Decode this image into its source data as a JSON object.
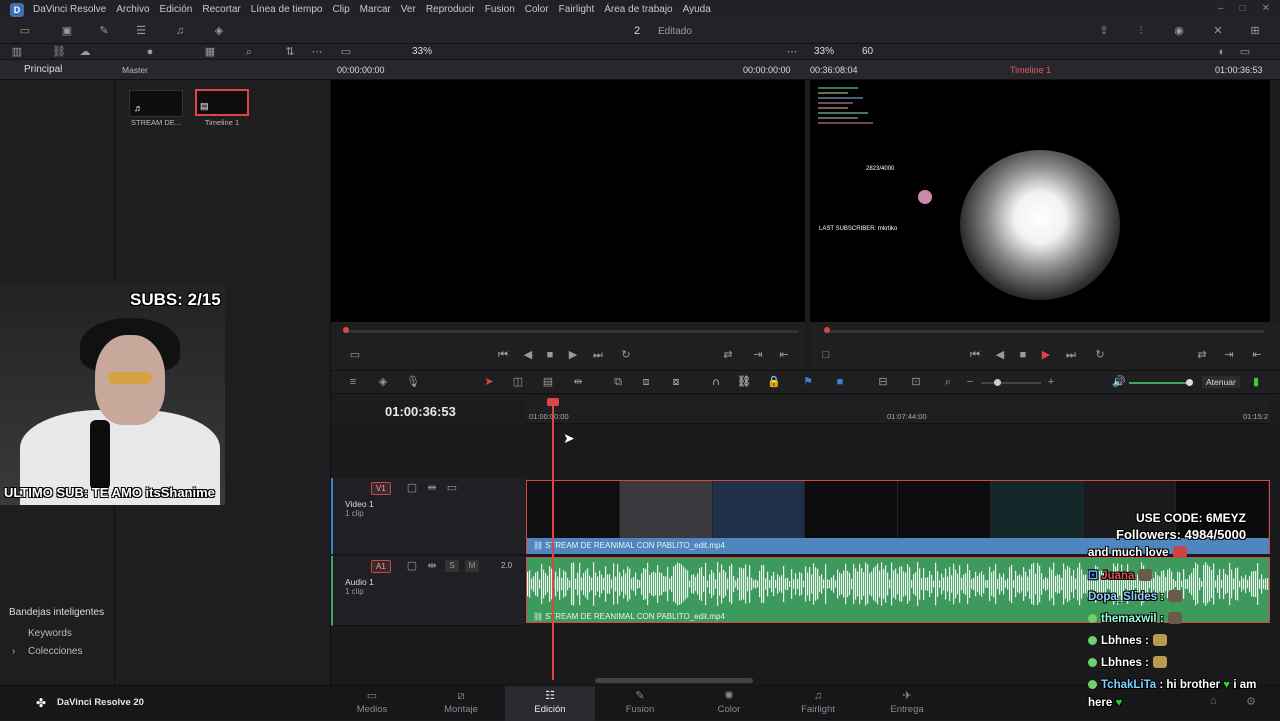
{
  "menubar": {
    "app_name": "DaVinci Resolve",
    "items": [
      "Archivo",
      "Edición",
      "Recortar",
      "Línea de tiempo",
      "Clip",
      "Marcar",
      "Ver",
      "Reproducir",
      "Fusion",
      "Color",
      "Fairlight",
      "Área de trabajo",
      "Ayuda"
    ]
  },
  "toolbar": {
    "project_count": "2",
    "project_state": "Editado"
  },
  "subbar": {
    "zoom_left": "33%",
    "zoom_right": "33%",
    "fps": "60"
  },
  "headbar": {
    "tab_principal": "Principal",
    "bin_master": "Master",
    "src_tc_in": "00:00:00:00",
    "src_tc_out": "00:00:00:00",
    "tl_tc_dur": "00:36:08:04",
    "timeline_name": "Timeline 1",
    "tl_tc_current": "01:00:36:53"
  },
  "mediapool": {
    "clips": [
      {
        "name": "STREAM DE..."
      },
      {
        "name": "Timeline 1"
      }
    ]
  },
  "leftpane": {
    "smart_bins": "Bandejas inteligentes",
    "keywords": "Keywords",
    "colecciones": "Colecciones"
  },
  "timeline": {
    "timecode": "01:00:36:53",
    "ruler": [
      "01:00:00:00",
      "01:07:44:00",
      "01:15:2"
    ],
    "atenuar": "Atenuar",
    "v1": {
      "tag": "V1",
      "name": "Video 1",
      "count": "1 clip",
      "clip_name": "STREAM DE REANIMAL CON PABLITO_edit.mp4"
    },
    "a1": {
      "tag": "A1",
      "name": "Audio 1",
      "count": "1 clip",
      "level": "2.0",
      "clip_name": "STREAM DE REANIMAL CON PABLITO_edit.mp4"
    }
  },
  "overlay": {
    "subs": "SUBS: 2/15",
    "ultimo_sub": "ULTIMO SUB: TE AMO itsShanime",
    "use_code": "USE CODE: 6MEYZ",
    "followers": "Followers: 4984/5000",
    "chat": [
      {
        "user": "",
        "msg": "and much love"
      },
      {
        "user": "Juana",
        "msg": ""
      },
      {
        "user": "Dopa_Slides",
        "msg": ":"
      },
      {
        "user": "themaxwil",
        "msg": ":"
      },
      {
        "user": "Lbhnes",
        "msg": ":"
      },
      {
        "user": "Lbhnes",
        "msg": ":"
      },
      {
        "user": "TchakLiTa",
        "msg": ": hi brother"
      },
      {
        "user": "",
        "msg": "i am"
      },
      {
        "user": "",
        "msg": "here"
      }
    ],
    "viewer_goal": "2823/4000",
    "viewer_last_sub": "LAST SUBSCRIBER: mkrtiko"
  },
  "pages": [
    "Medios",
    "Montaje",
    "Edición",
    "Fusion",
    "Color",
    "Fairlight",
    "Entrega"
  ],
  "active_page": "Edición",
  "brand": "DaVinci Resolve 20"
}
